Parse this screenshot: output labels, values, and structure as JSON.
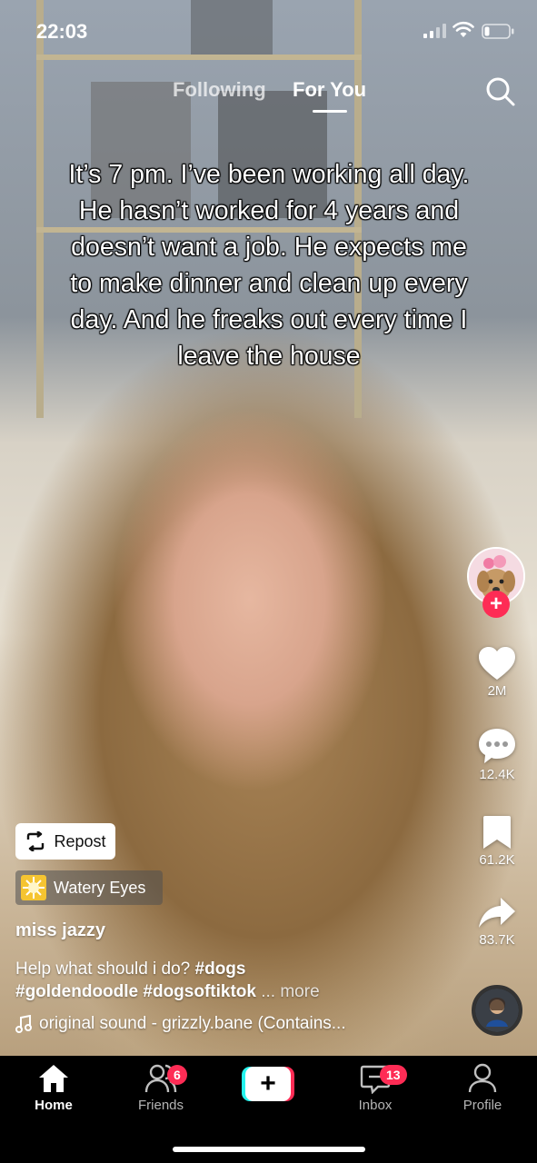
{
  "status_bar": {
    "time": "22:03"
  },
  "top_nav": {
    "tabs": [
      {
        "label": "Following"
      },
      {
        "label": "For You",
        "active": true
      }
    ]
  },
  "video": {
    "caption": "It’s 7 pm. I’ve been working all day. He hasn’t worked for 4 years and doesn’t want a job. He expects me to make dinner and clean up every day. And he freaks out every time I leave the house"
  },
  "actions": {
    "likes": "2M",
    "comments": "12.4K",
    "saves": "61.2K",
    "shares": "83.7K",
    "follow_symbol": "+"
  },
  "post": {
    "repost_label": "Repost",
    "effect_name": "Watery Eyes",
    "username": "miss jazzy",
    "description_text": "Help what should i do? ",
    "hashtags": [
      "#dogs",
      "#goldendoodle",
      "#dogsoftiktok"
    ],
    "more_label": "... more",
    "sound": "original sound - grizzly.bane (Contains..."
  },
  "bottom_nav": {
    "items": [
      {
        "label": "Home",
        "icon": "home-icon",
        "active": true
      },
      {
        "label": "Friends",
        "icon": "friends-icon",
        "badge": "6"
      },
      {
        "label": "",
        "icon": "create-icon",
        "symbol": "+"
      },
      {
        "label": "Inbox",
        "icon": "inbox-icon",
        "badge": "13"
      },
      {
        "label": "Profile",
        "icon": "profile-icon"
      }
    ]
  },
  "colors": {
    "accent": "#fe2c55",
    "cyan": "#25f4ee",
    "effect_chip": "#f5c431"
  }
}
